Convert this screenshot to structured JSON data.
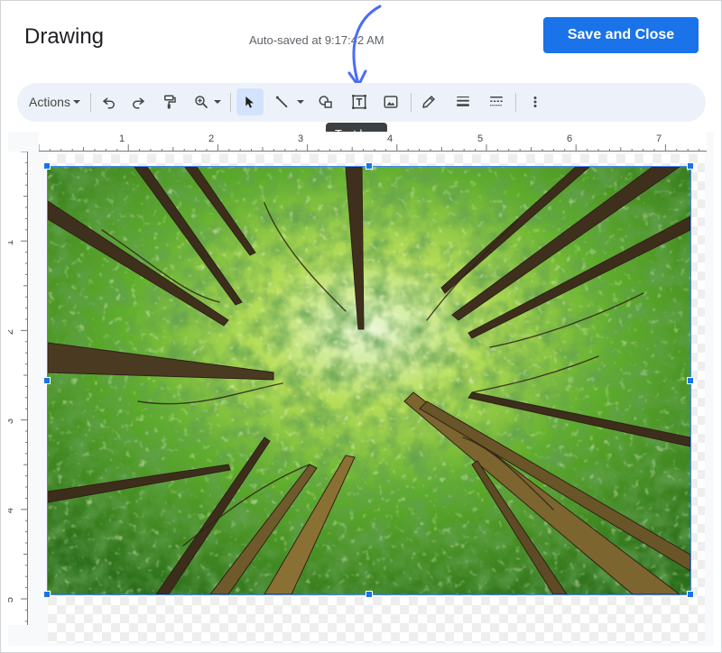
{
  "header": {
    "title": "Drawing",
    "autosave_text": "Auto-saved at 9:17:42 AM",
    "save_button_label": "Save and Close"
  },
  "toolbar": {
    "actions_label": "Actions",
    "tools": [
      {
        "name": "undo",
        "icon": "undo-icon"
      },
      {
        "name": "redo",
        "icon": "redo-icon"
      },
      {
        "name": "paint-format",
        "icon": "paint-roller-icon"
      },
      {
        "name": "zoom",
        "icon": "zoom-in-icon"
      },
      {
        "name": "select",
        "icon": "cursor-arrow-icon",
        "active": true
      },
      {
        "name": "line",
        "icon": "line-icon"
      },
      {
        "name": "shape",
        "icon": "shape-icon"
      },
      {
        "name": "text-box",
        "icon": "text-box-icon"
      },
      {
        "name": "image",
        "icon": "image-icon"
      },
      {
        "name": "border-color",
        "icon": "pencil-icon"
      },
      {
        "name": "border-weight",
        "icon": "line-weight-icon"
      },
      {
        "name": "border-dash",
        "icon": "line-dash-icon"
      },
      {
        "name": "more",
        "icon": "more-vert-icon"
      }
    ],
    "tooltip": "Text box"
  },
  "rulers": {
    "horizontal": [
      "1",
      "2",
      "3",
      "4",
      "5",
      "6",
      "7"
    ],
    "vertical": [
      "1",
      "2",
      "3",
      "4",
      "5"
    ]
  },
  "colors": {
    "primary": "#1a73e8",
    "toolbar_bg": "#edf2fa",
    "selection": "#4285f4",
    "annotation_arrow": "#4a6cf7"
  },
  "image": {
    "subject": "forest-canopy-photo"
  }
}
